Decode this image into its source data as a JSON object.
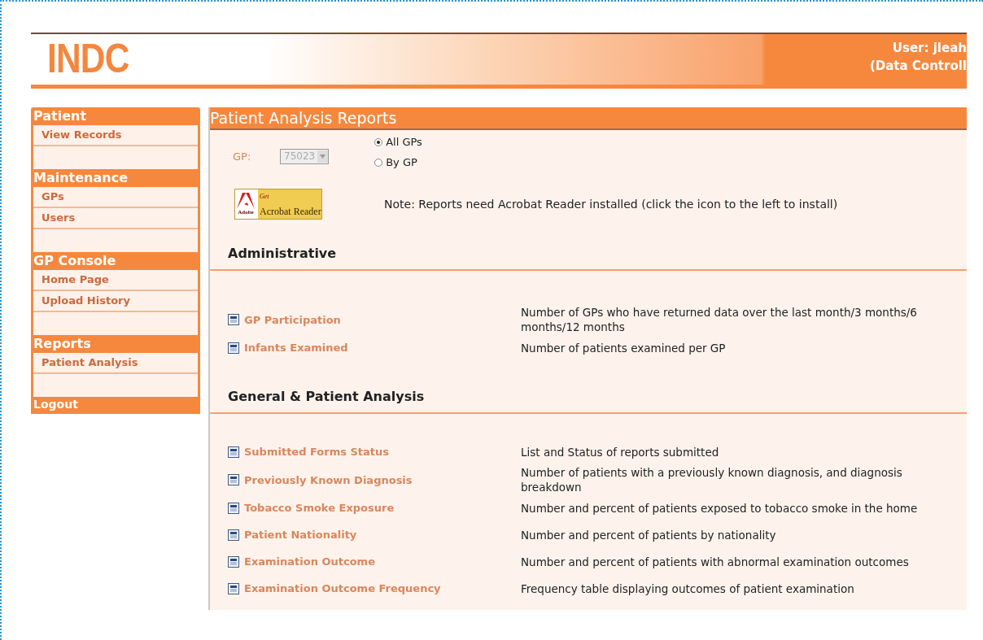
{
  "header": {
    "logo": "INDC",
    "user": "User: jleah",
    "role": "(Data Controll"
  },
  "sidebar": [
    {
      "title": "Patient",
      "items": [
        {
          "label": "View Records"
        }
      ]
    },
    {
      "title": "Maintenance",
      "items": [
        {
          "label": "GPs"
        },
        {
          "label": "Users"
        }
      ]
    },
    {
      "title": "GP Console",
      "items": [
        {
          "label": "Home Page"
        },
        {
          "label": "Upload History"
        }
      ]
    },
    {
      "title": "Reports",
      "items": [
        {
          "label": "Patient Analysis"
        }
      ]
    },
    {
      "title": "Logout"
    }
  ],
  "main": {
    "title": "Patient Analysis Reports",
    "gp_label": "GP:",
    "gp_select": {
      "value": "75023",
      "disabled": true
    },
    "scope": [
      {
        "label": "All GPs",
        "selected": true
      },
      {
        "label": "By GP",
        "selected": false
      }
    ],
    "acrobat": {
      "vendor": "Adobe",
      "get": "Get",
      "product": "Acrobat Reader"
    },
    "note": "Note: Reports need Acrobat Reader installed (click the icon to the left to install)",
    "sections": [
      {
        "title": "Administrative",
        "reports": [
          {
            "name": "GP Participation",
            "description": "Number of GPs who have returned data over the last month/3 months/6 months/12 months"
          },
          {
            "name": "Infants Examined",
            "description": "Number of patients examined per GP"
          }
        ]
      },
      {
        "title": "General & Patient Analysis",
        "reports": [
          {
            "name": "Submitted Forms Status",
            "description": "List and Status of reports submitted"
          },
          {
            "name": "Previously Known Diagnosis",
            "description": "Number of patients with a previously known diagnosis, and diagnosis breakdown"
          },
          {
            "name": "Tobacco Smoke Exposure",
            "description": "Number and percent of patients exposed to tobacco smoke in the home"
          },
          {
            "name": "Patient Nationality",
            "description": "Number and percent of patients by nationality"
          },
          {
            "name": "Examination Outcome",
            "description": "Number and percent of patients with abnormal examination outcomes"
          },
          {
            "name": "Examination Outcome Frequency",
            "description": "Frequency table displaying outcomes of patient examination"
          }
        ]
      }
    ]
  }
}
